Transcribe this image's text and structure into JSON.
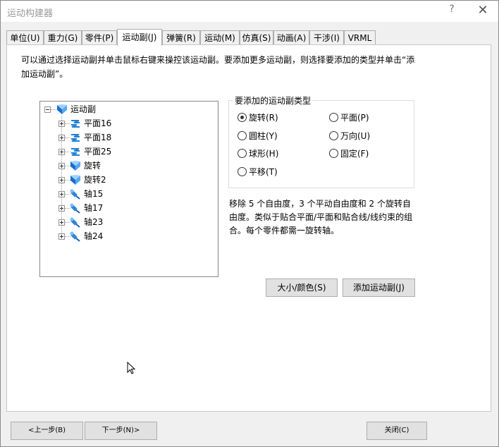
{
  "window": {
    "title": "运动构建器",
    "help": "?",
    "close": "✕"
  },
  "tabs": [
    {
      "label": "单位(U)"
    },
    {
      "label": "重力(G)"
    },
    {
      "label": "零件(P)"
    },
    {
      "label": "运动副(J)",
      "active": true
    },
    {
      "label": "弹簧(R)"
    },
    {
      "label": "运动(M)"
    },
    {
      "label": "仿真(S)"
    },
    {
      "label": "动画(A)"
    },
    {
      "label": "干涉(I)"
    },
    {
      "label": "VRML"
    }
  ],
  "description": "可以通过选择运动副并单击鼠标右键来操控该运动副。要添加更多运动副，则选择要添加的类型并单击“添加运动副”。",
  "tree": {
    "root": {
      "label": "运动副",
      "icon": "revolute-joint-icon"
    },
    "children": [
      {
        "label": "平面16",
        "icon": "planar-joint-icon"
      },
      {
        "label": "平面18",
        "icon": "planar-joint-icon"
      },
      {
        "label": "平面25",
        "icon": "planar-joint-icon"
      },
      {
        "label": "旋转",
        "icon": "revolute-joint-icon"
      },
      {
        "label": "旋转2",
        "icon": "revolute-joint-icon"
      },
      {
        "label": "轴15",
        "icon": "axis-joint-icon"
      },
      {
        "label": "轴17",
        "icon": "axis-joint-icon"
      },
      {
        "label": "轴23",
        "icon": "axis-joint-icon"
      },
      {
        "label": "轴24",
        "icon": "axis-joint-icon"
      }
    ]
  },
  "joint_types": {
    "title": "要添加的运动副类型",
    "options": [
      {
        "label": "旋转(R)",
        "selected": true
      },
      {
        "label": "平面(P)",
        "selected": false
      },
      {
        "label": "圆柱(Y)",
        "selected": false
      },
      {
        "label": "万向(U)",
        "selected": false
      },
      {
        "label": "球形(H)",
        "selected": false
      },
      {
        "label": "固定(F)",
        "selected": false
      },
      {
        "label": "平移(T)",
        "selected": false
      }
    ]
  },
  "info": "移除 5 个自由度，3 个平动自由度和 2 个旋转自由度。类似于贴合平面/平面和贴合线/线约束的组合。每个零件都需一旋转轴。",
  "buttons": {
    "size_color": "大小/颜色(S)",
    "add_joint": "添加运动副(J)",
    "prev": "<上一步(B)",
    "next": "下一步(N)>",
    "close": "关闭(C)"
  },
  "colors": {
    "planar_icon": "#1e7fd6",
    "revolute_icon": "#1a6fc9",
    "axis_icon": "#2b86d9"
  }
}
